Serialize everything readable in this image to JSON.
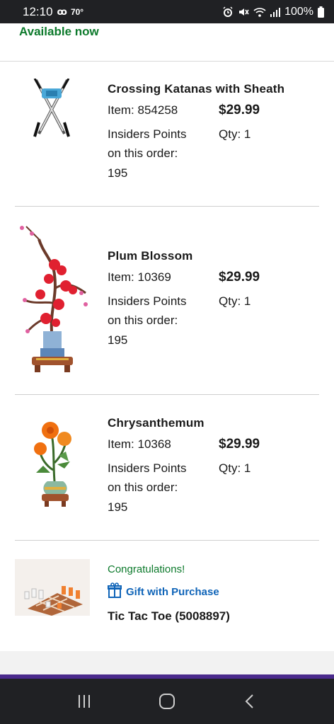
{
  "status_bar": {
    "time": "12:10",
    "voicemail": "ꝏ",
    "temperature": "70°",
    "battery": "100%"
  },
  "availability": "Available now",
  "items": [
    {
      "name": "Crossing Katanas with Sheath",
      "item_label": "Item: 854258",
      "price": "$29.99",
      "points_line1": "Insiders Points",
      "points_line2": "on this order:",
      "points_value": "195",
      "qty": "Qty: 1"
    },
    {
      "name": "Plum Blossom",
      "item_label": "Item: 10369",
      "price": "$29.99",
      "points_line1": "Insiders Points",
      "points_line2": "on this order:",
      "points_value": "195",
      "qty": "Qty: 1"
    },
    {
      "name": "Chrysanthemum",
      "item_label": "Item: 10368",
      "price": "$29.99",
      "points_line1": "Insiders Points",
      "points_line2": "on this order:",
      "points_value": "195",
      "qty": "Qty: 1"
    }
  ],
  "gift": {
    "congrats": "Congratulations!",
    "label": "Gift with Purchase",
    "name": "Tic Tac Toe (5008897)"
  },
  "icons": {
    "alarm": "alarm-icon",
    "mute": "mute-icon",
    "wifi": "wifi-icon",
    "signal": "signal-icon",
    "battery": "battery-icon",
    "gift": "gift-icon",
    "recents": "recents-icon",
    "home": "home-icon",
    "back": "back-icon"
  },
  "colors": {
    "accent_green": "#0d7a2c",
    "link_blue": "#0f64b8",
    "purple": "#4a2a8c"
  }
}
